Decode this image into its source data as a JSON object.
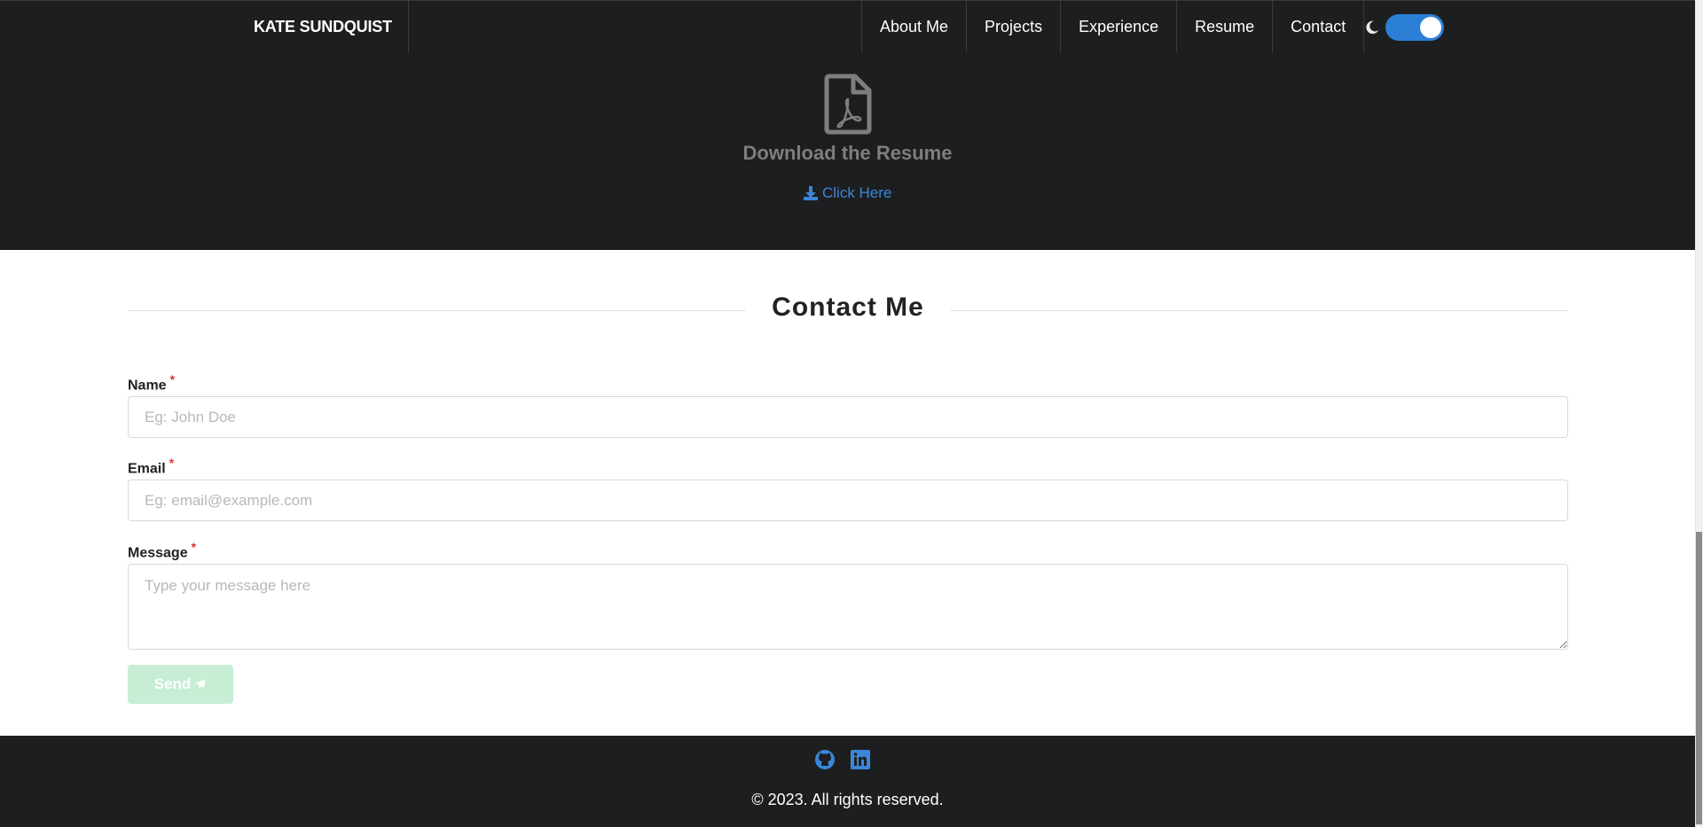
{
  "navbar": {
    "brand": "KATE SUNDQUIST",
    "links": [
      {
        "label": "About Me"
      },
      {
        "label": "Projects"
      },
      {
        "label": "Experience"
      },
      {
        "label": "Resume"
      },
      {
        "label": "Contact"
      }
    ],
    "theme_toggle": {
      "icon": "moon-icon",
      "state": "on",
      "accent": "#2b7fd6"
    }
  },
  "resume": {
    "icon": "pdf-file-icon",
    "title": "Download the Resume",
    "link_label": "Click Here",
    "link_icon": "download-icon",
    "link_color": "#3a87d8"
  },
  "contact": {
    "heading": "Contact Me",
    "name": {
      "label": "Name",
      "required": "*",
      "placeholder": "Eg: John Doe",
      "value": ""
    },
    "email": {
      "label": "Email",
      "required": "*",
      "placeholder": "Eg: email@example.com",
      "value": ""
    },
    "message": {
      "label": "Message",
      "required": "*",
      "placeholder": "Type your message here",
      "value": ""
    },
    "send_label": "Send",
    "send_icon": "paper-plane-icon",
    "send_color": "#c7edd5"
  },
  "footer": {
    "social": [
      {
        "icon": "github-icon"
      },
      {
        "icon": "linkedin-icon"
      }
    ],
    "copyright": "© 2023. All rights reserved.",
    "icon_color": "#3a87d8"
  },
  "colors": {
    "dark_bg": "#1d1e20",
    "required": "#d9342b"
  }
}
